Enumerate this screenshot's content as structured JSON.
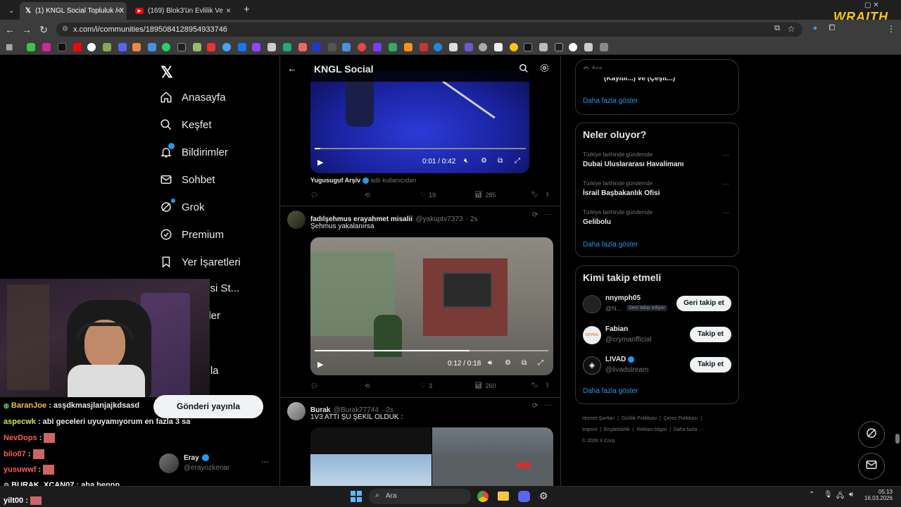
{
  "browser": {
    "tabs": [
      {
        "label": "(1) KNGL Social Topluluk / X",
        "icon": "x-icon"
      },
      {
        "label": "(169) Blok3'ün Evlilik Ve Çocuk",
        "icon": "youtube-icon"
      }
    ],
    "new_tab": "+",
    "url": "x.com/i/communities/1895084128954933746",
    "overlay_logo": "WRAITH"
  },
  "sidebar": {
    "items": [
      {
        "label": "Anasayfa",
        "icon": "home-icon"
      },
      {
        "label": "Keşfet",
        "icon": "search-icon"
      },
      {
        "label": "Bildirimler",
        "icon": "bell-icon"
      },
      {
        "label": "Sohbet",
        "icon": "mail-icon"
      },
      {
        "label": "Grok",
        "icon": "grok-icon"
      },
      {
        "label": "Premium",
        "icon": "premium-icon"
      },
      {
        "label": "Yer İşaretleri",
        "icon": "bookmark-icon"
      },
      {
        "label": "Üreticisi St...",
        "icon": ""
      },
      {
        "label": "eler",
        "icon": ""
      },
      {
        "label": "azla",
        "icon": ""
      }
    ],
    "post_button": "Gönderi yayınla",
    "account": {
      "name": "Eray",
      "handle": "@erayozkenar",
      "more": "···"
    }
  },
  "main": {
    "header_title": "KNGL Social",
    "tweet1": {
      "video_time": "0:01 / 0:42",
      "attribution_name": "Yugusuguf Arşiv",
      "attribution_suffix": "adlı kullanıcıdan",
      "actions": {
        "replies": "",
        "reposts": "",
        "likes": "19",
        "views": "285"
      }
    },
    "tweet2": {
      "name": "fadılşehmus erayahmet misalii",
      "handle": "@yakuptv7373",
      "time": "· 2s",
      "text": "Şehmus yakalanırsa",
      "video_time": "0:12 / 0:18",
      "actions": {
        "replies": "",
        "reposts": "",
        "likes": "3",
        "views": "260"
      }
    },
    "tweet3": {
      "name": "Burak",
      "handle": "@Burak77744",
      "time": "· 2s",
      "text": "1V3 ATTI ŞU ŞEKİL OLDUK :"
    }
  },
  "right": {
    "search_placeholder": "Ara",
    "top_partial": "(Kayıtlı...) ve (Çeşit...)",
    "show_more": "Daha fazla göster",
    "trends_title": "Neler oluyor?",
    "trends": [
      {
        "context": "Türkiye tarihinde gündemde",
        "title": "Dubai Uluslararası Havalimanı"
      },
      {
        "context": "Türkiye tarihinde gündemde",
        "title": "İsrail Başbakanlık Ofisi"
      },
      {
        "context": "Türkiye tarihinde gündemde",
        "title": "Gelibolu"
      }
    ],
    "follow_title": "Kimi takip etmeli",
    "suggestions": [
      {
        "name": "nnymph05",
        "handle": "@N...",
        "badge": "Seni takip ediyor",
        "button": "Geri takip et"
      },
      {
        "name": "Fabian",
        "handle": "@crymaofficial",
        "badge": "",
        "button": "Takip et"
      },
      {
        "name": "LIVAD",
        "handle": "@livadstream",
        "badge": "",
        "button": "Takip et"
      }
    ],
    "footer": {
      "links": [
        "Hizmet Şartları",
        "Gizlilik Politikası",
        "Çerez Politikası",
        "Imprint",
        "Erişilebilirlik",
        "Reklam bilgisi",
        "Daha fazla ···"
      ],
      "copyright": "© 2026 X Corp."
    }
  },
  "chat": [
    {
      "user": "BaranJoe",
      "text": ": asşdkmasjlanjajkdsasd",
      "color": "#f0c040"
    },
    {
      "user": "aspecwk",
      "text": ": abi geceleri uyuyamıyorum en fazla 3 sa",
      "color": "#c8e64a"
    },
    {
      "user": "NevDops",
      "text": ":",
      "color": "#ff5a5a"
    },
    {
      "user": "bilo07",
      "text": ":",
      "color": "#ff5a5a"
    },
    {
      "user": "yusuwwf",
      "text": ":",
      "color": "#ff5a5a"
    },
    {
      "user": "BURAK_XCAN07",
      "text": ": aba bennn",
      "color": "#ffffff"
    },
    {
      "user": "yilt00",
      "text": ":",
      "color": "#ffffff"
    }
  ],
  "taskbar": {
    "search": "Ara",
    "time": "05:13",
    "date": "16.03.2026"
  },
  "colors": {
    "accent": "#1d9bf0",
    "background": "#000000",
    "border": "#2f3336"
  }
}
